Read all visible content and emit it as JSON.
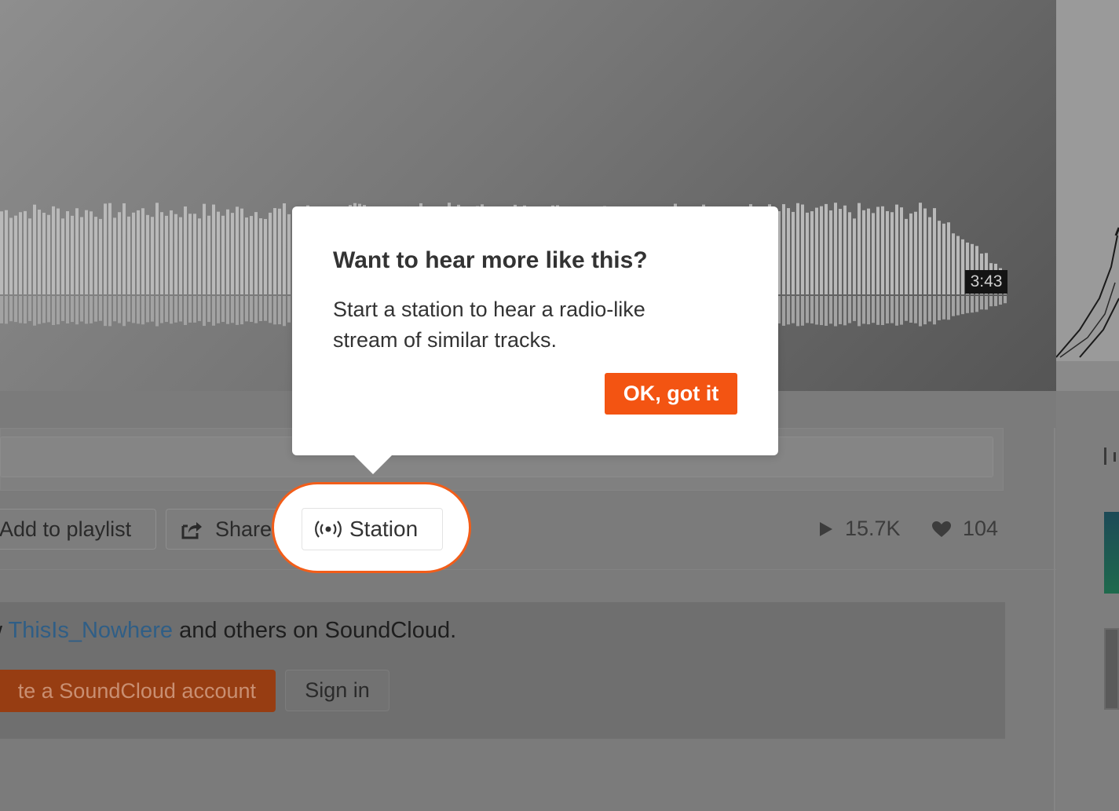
{
  "player": {
    "duration": "3:43"
  },
  "actions": {
    "add_to_playlist_label": "Add to playlist",
    "share_label": "Share",
    "station_label": "Station"
  },
  "stats": {
    "plays": "15.7K",
    "likes": "104"
  },
  "signup": {
    "prefix": "w ",
    "username": "ThisIs_Nowhere",
    "suffix": " and others on SoundCloud.",
    "create_account_label": "te a SoundCloud account",
    "sign_in_label": "Sign in"
  },
  "popover": {
    "title": "Want to hear more like this?",
    "body_line1": "Start a station to hear a radio-like",
    "body_line2": "stream of similar tracks.",
    "ok_label": "OK, got it"
  },
  "colors": {
    "accent": "#f35412",
    "link": "#2f5e86"
  },
  "icons": {
    "share": "share-icon",
    "station": "station-icon",
    "play": "play-icon",
    "like": "heart-icon"
  }
}
